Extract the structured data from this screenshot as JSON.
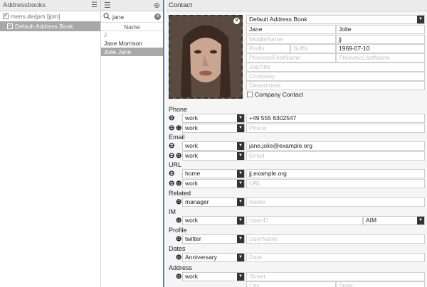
{
  "addressbooks": {
    "title": "Addressbooks",
    "account": "mens.de/jpm [jpm]",
    "book": "Default Address Book"
  },
  "list": {
    "search_value": "jane",
    "column": "Name",
    "group": "J",
    "contacts": [
      "Jane Morrison",
      "Jolie Jane"
    ]
  },
  "contact": {
    "title": "Contact",
    "addressbook": "Default Address Book",
    "first_name": "Jane",
    "last_name": "Jolie",
    "middle_placeholder": "MiddleName",
    "middle_value": "jj",
    "prefix_placeholder": "Prefix",
    "suffix_placeholder": "Suffix",
    "birthday": "1969-07-10",
    "phonetic_first_placeholder": "PhoneticFirstName",
    "phonetic_last_placeholder": "PhoneticLastName",
    "jobtitle_placeholder": "JobTitle",
    "company_placeholder": "Company",
    "department_placeholder": "Department",
    "company_contact_label": "Company Contact",
    "phone": {
      "label": "Phone",
      "rows": [
        {
          "type": "work",
          "value": "+49 555 6302547",
          "placeholder": ""
        },
        {
          "type": "work",
          "value": "",
          "placeholder": "Phone"
        }
      ]
    },
    "email": {
      "label": "Email",
      "rows": [
        {
          "type": "work",
          "value": "jane.jolie@example.org",
          "placeholder": ""
        },
        {
          "type": "work",
          "value": "",
          "placeholder": "Email"
        }
      ]
    },
    "url": {
      "label": "URL",
      "rows": [
        {
          "type": "home",
          "value": "jj.example.org",
          "placeholder": ""
        },
        {
          "type": "work",
          "value": "",
          "placeholder": "URL"
        }
      ]
    },
    "related": {
      "label": "Related",
      "type": "manager",
      "placeholder": "Name"
    },
    "im": {
      "label": "IM",
      "type": "work",
      "placeholder": "UserID",
      "service": "AIM"
    },
    "profile": {
      "label": "Profile",
      "type": "twitter",
      "placeholder": "UserName"
    },
    "dates": {
      "label": "Dates",
      "type": "Anniversary",
      "placeholder": "Date"
    },
    "address": {
      "label": "Address",
      "type": "work",
      "street_placeholder": "Street",
      "city_placeholder": "City",
      "state_placeholder": "State"
    }
  },
  "colors": {
    "accent": "#5a7ec7",
    "selection": "#a8a8a8"
  }
}
